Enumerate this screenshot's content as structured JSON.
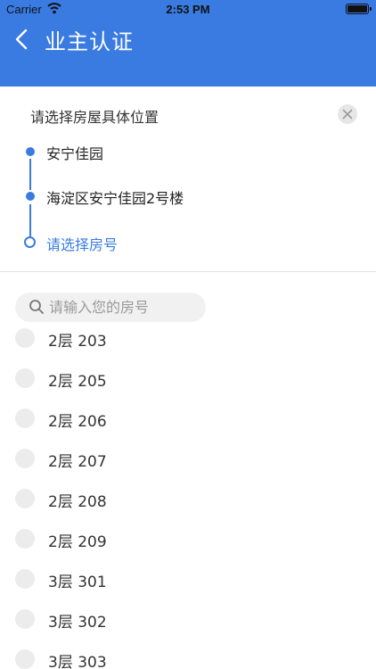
{
  "status_bar": {
    "carrier": "Carrier",
    "time": "2:53 PM"
  },
  "nav": {
    "title": "业主认证"
  },
  "location": {
    "prompt": "请选择房屋具体位置",
    "steps": [
      {
        "label": "安宁佳园",
        "state": "done"
      },
      {
        "label": "海淀区安宁佳园2号楼",
        "state": "done"
      },
      {
        "label": "请选择房号",
        "state": "current"
      }
    ]
  },
  "search": {
    "placeholder": "请输入您的房号",
    "value": ""
  },
  "rooms": [
    {
      "label": "2层 203"
    },
    {
      "label": "2层 205"
    },
    {
      "label": "2层 206"
    },
    {
      "label": "2层 207"
    },
    {
      "label": "2层 208"
    },
    {
      "label": "2层 209"
    },
    {
      "label": "3层 301"
    },
    {
      "label": "3层 302"
    },
    {
      "label": "3层 303"
    }
  ],
  "colors": {
    "accent": "#3a7be2",
    "radio": "#ececec"
  }
}
